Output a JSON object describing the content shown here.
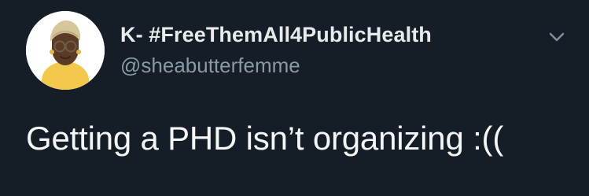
{
  "tweet": {
    "display_name": "K- #FreeThemAll4PublicHealth",
    "handle": "@sheabutterfemme",
    "text": "Getting a PHD isn’t organizing :((",
    "avatar_icon": "profile-avatar-icon",
    "menu_icon": "chevron-down-icon"
  },
  "colors": {
    "background": "#151d27",
    "display_name": "#e8eaec",
    "handle": "#8a99a8",
    "text": "#f4f6f8",
    "avatar_background": "#ffffff",
    "avatar_shirt": "#f2c94c",
    "avatar_skin": "#5b3b25",
    "avatar_headwrap": "#d6c79a",
    "menu_icon": "#7f8d9b"
  }
}
